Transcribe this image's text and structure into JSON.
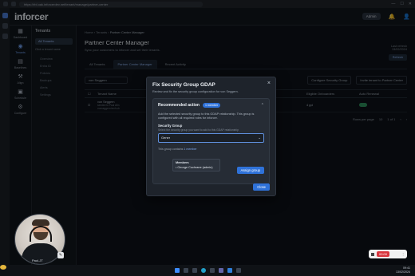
{
  "browser": {
    "url": "https://rbl.oak.inforcerdev.net/tenant/manage/partner-center"
  },
  "app": {
    "logo": "inforcer",
    "user_menu": "Admin"
  },
  "nav": [
    {
      "icon": "▦",
      "label": "Dashboard"
    },
    {
      "icon": "◉",
      "label": "Tenants"
    },
    {
      "icon": "▤",
      "label": "Baselines"
    },
    {
      "icon": "⚒",
      "label": "Align"
    },
    {
      "icon": "▣",
      "label": "Schedule"
    },
    {
      "icon": "⚙",
      "label": "Configure"
    }
  ],
  "tenants_panel": {
    "title": "Tenants",
    "selected": "All Tenants",
    "note": "Click a tenant name",
    "items": [
      "Overview",
      "Entra ID",
      "Policies",
      "Backups",
      "Alerts",
      "Settings"
    ]
  },
  "page": {
    "breadcrumb": [
      "Home",
      "Tenants",
      "Partner Center Manager"
    ],
    "title": "Partner Center Manager",
    "subtitle": "Sync your customers to inforcer and set their tenants.",
    "sync_note": "Last refresh",
    "sync_time": "13/02/2024",
    "refresh_btn": "Refresh",
    "tabs": [
      "All Tenants",
      "Partner Center Manager",
      "Recent Activity"
    ],
    "search_value": "von Seggern",
    "configure_btn": "Configure Security Group",
    "invite_btn": "Invite tenant to Partner Center",
    "columns": [
      "",
      "Tenant Name",
      "",
      "GDAP",
      "Eligible Onboarders",
      "Auto Renewal"
    ],
    "rows": [
      {
        "name": "von Seggern",
        "sub1": "seeded to Paul Afin",
        "sub2": "vonseggern.tech.uk",
        "gdap": "GDAP",
        "onboarders": "4 ppl",
        "renew": "on"
      }
    ],
    "pager": {
      "rows_label": "Rows per page",
      "rows_value": "10",
      "range": "1 of 1"
    }
  },
  "modal": {
    "title": "Fix Security Group GDAP",
    "subtitle": "Review and fix the security group configuration for von Seggern.",
    "card_title": "Recommended action",
    "pill": "1 member",
    "desc": "Add the selected security group to this GDAP relationship. This group is configured with all required roles for inforcer.",
    "group_label": "Security Group",
    "group_help": "Select the security group you want to add to this GDAP relationship",
    "select_value": "Gener",
    "dropdown_head": "Members",
    "dropdown_item": "George Cochrane (admin)",
    "contains_label": "This group contains",
    "contains_link": "1 member",
    "assign_btn": "Assign group",
    "close_btn": "Close"
  },
  "webcam": {
    "label": "Paul-JT"
  },
  "recorder": {
    "time": "00:00"
  },
  "taskbar": {
    "time": "09:41",
    "date": "13/02/2024"
  }
}
